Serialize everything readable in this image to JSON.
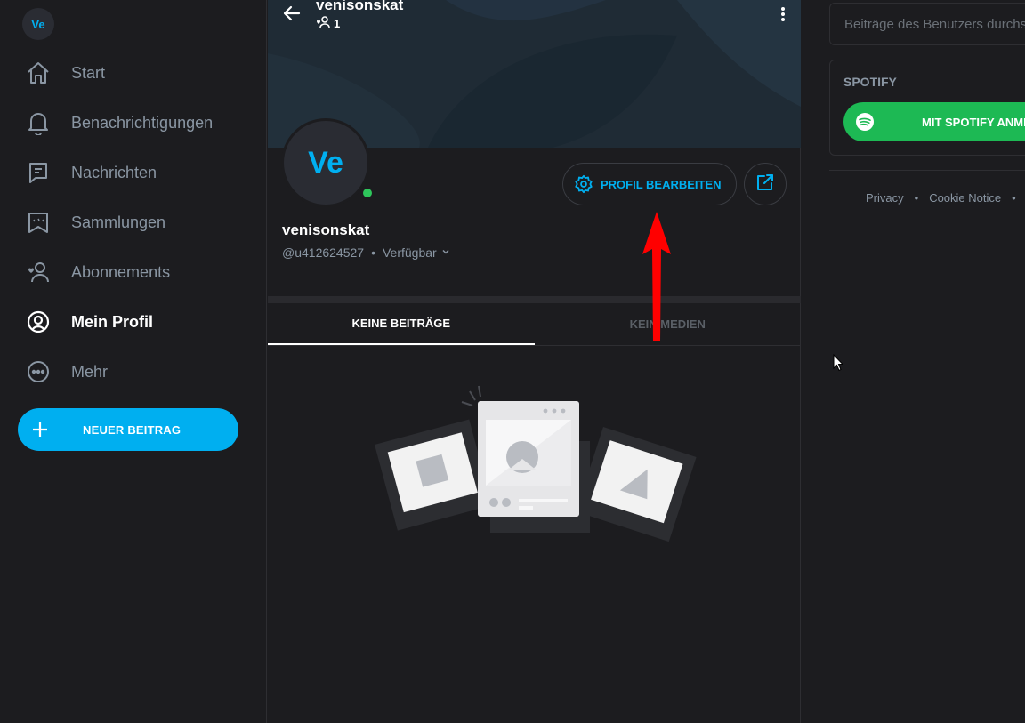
{
  "sidebar": {
    "avatar_initials": "Ve",
    "items": [
      {
        "label": "Start",
        "icon": "home-icon"
      },
      {
        "label": "Benachrichtigungen",
        "icon": "bell-icon"
      },
      {
        "label": "Nachrichten",
        "icon": "message-icon"
      },
      {
        "label": "Sammlungen",
        "icon": "bookmark-stars-icon"
      },
      {
        "label": "Abonnements",
        "icon": "subscriptions-icon"
      },
      {
        "label": "Mein Profil",
        "icon": "profile-icon",
        "active": true
      },
      {
        "label": "Mehr",
        "icon": "more-icon"
      }
    ],
    "new_post_label": "NEUER BEITRAG"
  },
  "profile": {
    "top_name": "venisonskat",
    "subscriber_count": "1",
    "avatar_initials": "Ve",
    "name": "venisonskat",
    "handle": "@u412624527",
    "separator": "•",
    "status": "Verfügbar",
    "edit_button_label": "PROFIL BEARBEITEN",
    "online": true
  },
  "tabs": [
    {
      "label": "KEINE BEITRÄGE",
      "active": true
    },
    {
      "label": "KEIN MEDIEN",
      "active": false
    }
  ],
  "right": {
    "search_placeholder": "Beiträge des Benutzers durchsuchen",
    "spotify_title": "SPOTIFY",
    "spotify_button_label": "MIT SPOTIFY ANMELDEN",
    "footer_links": [
      "Privacy",
      "Cookie Notice"
    ],
    "footer_separator": "•"
  },
  "colors": {
    "accent": "#00aff0",
    "background": "#1c1c1f",
    "spotify_green": "#1db954",
    "online_green": "#2ec65b",
    "annotation_red": "#ff0000"
  }
}
